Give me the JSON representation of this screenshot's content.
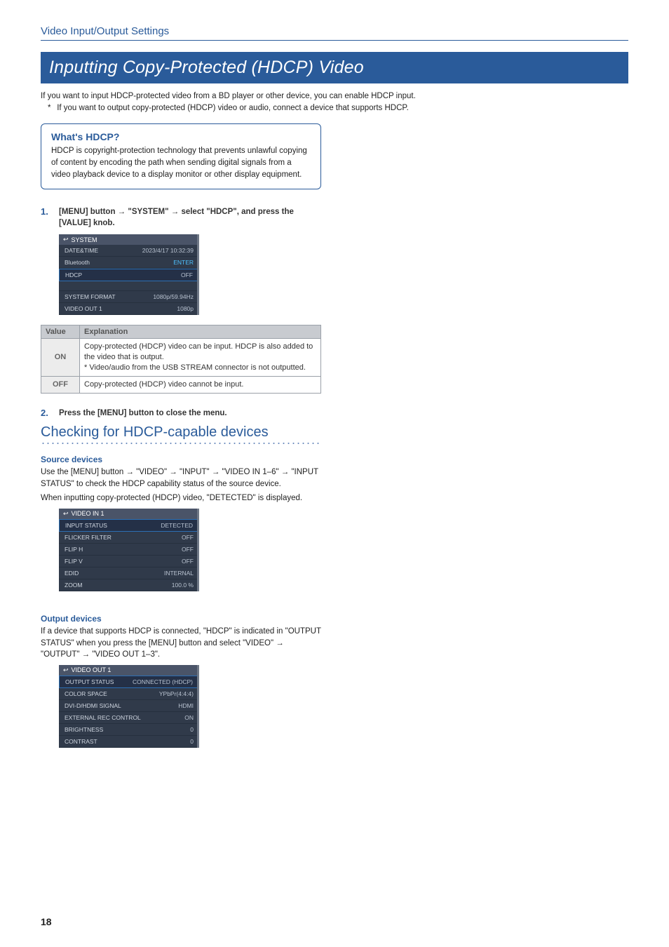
{
  "breadcrumb": "Video Input/Output Settings",
  "h1": "Inputting Copy-Protected (HDCP) Video",
  "intro_line": "If you want to input HDCP-protected video from a BD player or other device, you can enable HDCP input.",
  "intro_note": "If you want to output copy-protected (HDCP) video or audio, connect a device that supports HDCP.",
  "callout": {
    "title": "What's HDCP?",
    "body": "HDCP is copyright-protection technology that prevents unlawful copying of content by encoding the path when sending digital signals from a video playback device to a display monitor or other display equipment."
  },
  "step1": {
    "num": "1.",
    "text": "[MENU] button → \"SYSTEM\" → select \"HDCP\", and press the [VALUE] knob."
  },
  "system_menu": {
    "title": "SYSTEM",
    "rows": [
      {
        "label": "DATE&TIME",
        "value": "2023/4/17 10:32:39"
      },
      {
        "label": "Bluetooth",
        "value": "ENTER",
        "enter": true
      },
      {
        "label": "HDCP",
        "value": "OFF",
        "highlight": true
      },
      {
        "label": "",
        "value": "",
        "spacer": true
      },
      {
        "label": "SYSTEM FORMAT",
        "value": "1080p/59.94Hz"
      },
      {
        "label": "VIDEO OUT 1",
        "value": "1080p"
      }
    ]
  },
  "value_table": {
    "headers": [
      "Value",
      "Explanation"
    ],
    "rows": [
      {
        "key": "ON",
        "explanation": "Copy-protected (HDCP) video can be input. HDCP is also added to the video that is output.\n* Video/audio from the USB STREAM connector is not outputted."
      },
      {
        "key": "OFF",
        "explanation": "Copy-protected (HDCP) video cannot be input."
      }
    ]
  },
  "step2": {
    "num": "2.",
    "text": "Press the [MENU] button to close the menu."
  },
  "subheading": "Checking for HDCP-capable devices",
  "source": {
    "title": "Source devices",
    "p1": "Use the [MENU] button → \"VIDEO\" → \"INPUT\" → \"VIDEO IN 1–6\" → \"INPUT STATUS\" to check the HDCP capability status of the source device.",
    "p2": "When inputting copy-protected (HDCP) video, \"DETECTED\" is displayed."
  },
  "video_in_menu": {
    "title": "VIDEO IN 1",
    "rows": [
      {
        "label": "INPUT STATUS",
        "value": "DETECTED",
        "highlight": true
      },
      {
        "label": "FLICKER FILTER",
        "value": "OFF"
      },
      {
        "label": "FLIP H",
        "value": "OFF"
      },
      {
        "label": "FLIP V",
        "value": "OFF"
      },
      {
        "label": "EDID",
        "value": "INTERNAL"
      },
      {
        "label": "ZOOM",
        "value": "100.0 %"
      }
    ]
  },
  "output": {
    "title": "Output devices",
    "p1": "If a device that supports HDCP is connected, \"HDCP\" is indicated in \"OUTPUT STATUS\" when you press the [MENU] button and select \"VIDEO\" → \"OUTPUT\" → \"VIDEO OUT 1–3\"."
  },
  "video_out_menu": {
    "title": "VIDEO OUT 1",
    "rows": [
      {
        "label": "OUTPUT STATUS",
        "value": "CONNECTED (HDCP)",
        "highlight": true
      },
      {
        "label": "COLOR SPACE",
        "value": "YPbPr(4:4:4)"
      },
      {
        "label": "DVI-D/HDMI SIGNAL",
        "value": "HDMI"
      },
      {
        "label": "EXTERNAL REC CONTROL",
        "value": "ON"
      },
      {
        "label": "BRIGHTNESS",
        "value": "0"
      },
      {
        "label": "CONTRAST",
        "value": "0"
      }
    ]
  },
  "page_number": "18"
}
